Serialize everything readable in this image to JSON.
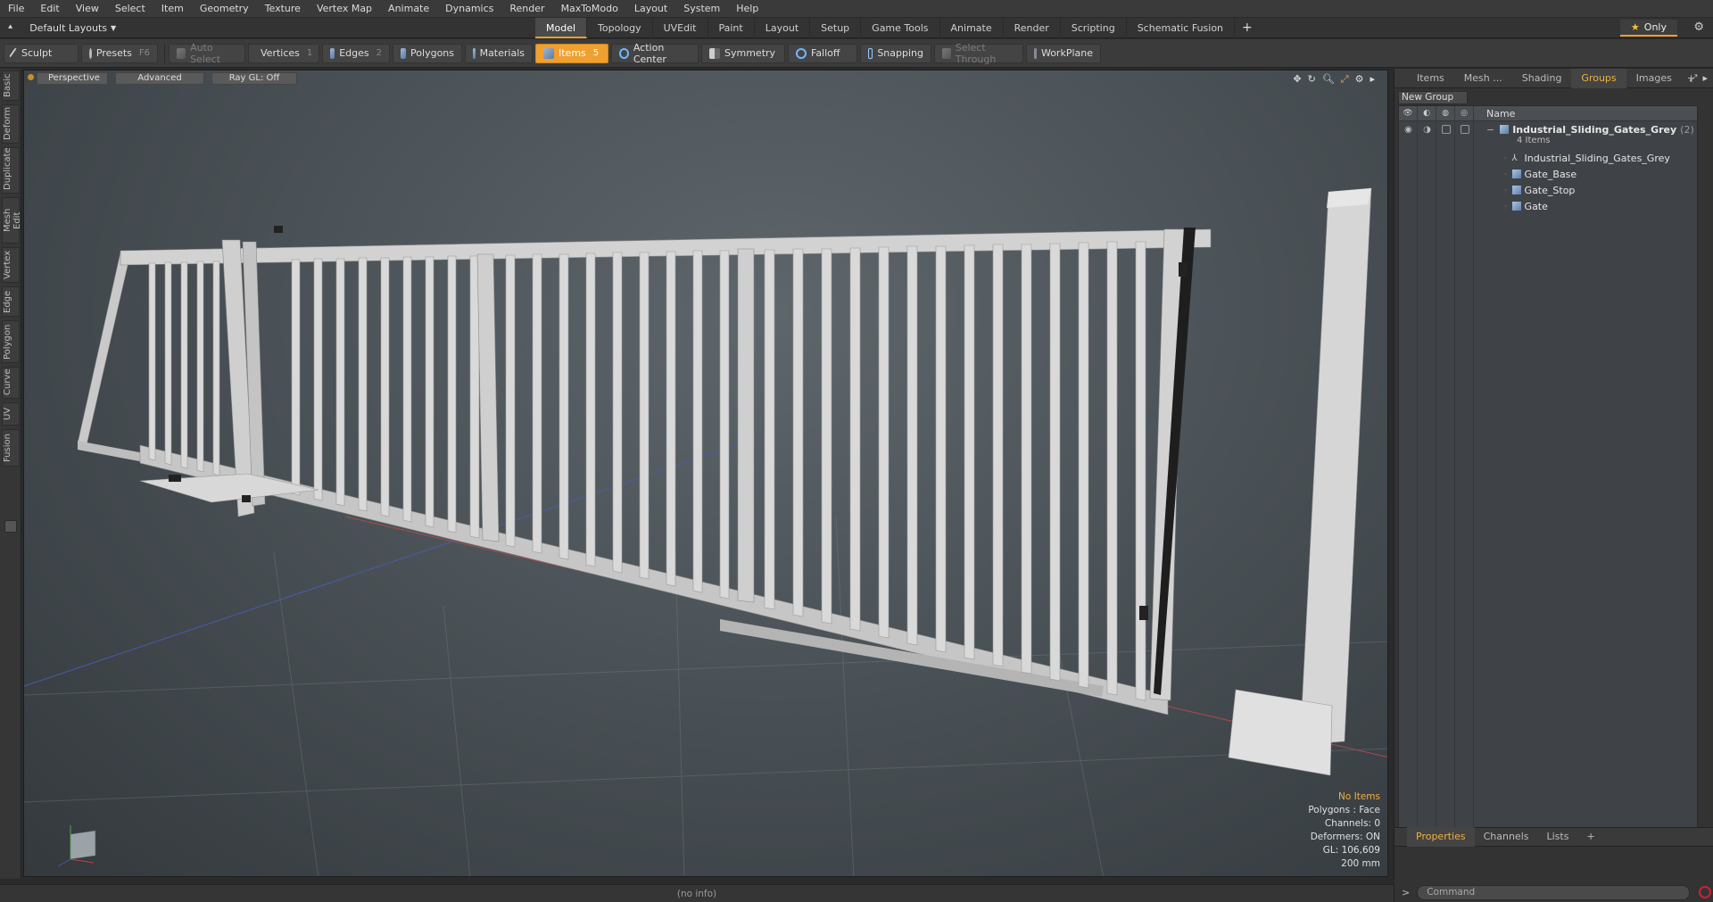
{
  "menu": [
    "File",
    "Edit",
    "View",
    "Select",
    "Item",
    "Geometry",
    "Texture",
    "Vertex Map",
    "Animate",
    "Dynamics",
    "Render",
    "MaxToModo",
    "Layout",
    "System",
    "Help"
  ],
  "layout_dropdown": "Default Layouts",
  "tabs": [
    {
      "label": "Model",
      "active": true
    },
    {
      "label": "Topology",
      "active": false
    },
    {
      "label": "UVEdit",
      "active": false
    },
    {
      "label": "Paint",
      "active": false
    },
    {
      "label": "Layout",
      "active": false
    },
    {
      "label": "Setup",
      "active": false
    },
    {
      "label": "Game Tools",
      "active": false
    },
    {
      "label": "Animate",
      "active": false
    },
    {
      "label": "Render",
      "active": false
    },
    {
      "label": "Scripting",
      "active": false
    },
    {
      "label": "Schematic Fusion",
      "active": false
    }
  ],
  "tab_add": "+",
  "only_label": "Only",
  "toolbar": {
    "sculpt": "Sculpt",
    "presets": "Presets",
    "presets_key": "F6",
    "auto_select": "Auto Select",
    "vertices": "Vertices",
    "vertices_key": "1",
    "edges": "Edges",
    "edges_key": "2",
    "polygons": "Polygons",
    "materials": "Materials",
    "items": "Items",
    "items_key": "5",
    "action_center": "Action Center",
    "symmetry": "Symmetry",
    "falloff": "Falloff",
    "snapping": "Snapping",
    "select_through": "Select Through",
    "workplane": "WorkPlane"
  },
  "left_tabs": [
    "Basic",
    "Deform",
    "Duplicate",
    "Mesh Edit",
    "Vertex",
    "Edge",
    "Polygon",
    "Curve",
    "UV",
    "Fusion"
  ],
  "viewport": {
    "view_mode": "Perspective",
    "shading": "Advanced",
    "raygl": "Ray GL: Off",
    "info": {
      "selection": "No Items",
      "polygons": "Polygons : Face",
      "channels": "Channels: 0",
      "deformers": "Deformers: ON",
      "gl": "GL: 106,609",
      "grid": "200 mm"
    }
  },
  "right_panel": {
    "tabs": [
      {
        "label": "Items",
        "active": false
      },
      {
        "label": "Mesh ...",
        "active": false
      },
      {
        "label": "Shading",
        "active": false
      },
      {
        "label": "Groups",
        "active": true
      },
      {
        "label": "Images",
        "active": false
      }
    ],
    "new_group": "New Group",
    "column_name": "Name",
    "group": {
      "name": "Industrial_Sliding_Gates_Grey",
      "count": "(2)",
      "subtitle": "4 Items",
      "children": [
        {
          "name": "Industrial_Sliding_Gates_Grey",
          "icon": "locator-icon"
        },
        {
          "name": "Gate_Base",
          "icon": "mesh-icon"
        },
        {
          "name": "Gate_Stop",
          "icon": "mesh-icon"
        },
        {
          "name": "Gate",
          "icon": "mesh-icon"
        }
      ]
    },
    "bottom_tabs": [
      {
        "label": "Properties",
        "active": true
      },
      {
        "label": "Channels",
        "active": false
      },
      {
        "label": "Lists",
        "active": false
      }
    ],
    "command_placeholder": "Command"
  },
  "status": "(no info)",
  "colors": {
    "accent": "#f0a030",
    "viewport_bg": "#4b5257"
  }
}
